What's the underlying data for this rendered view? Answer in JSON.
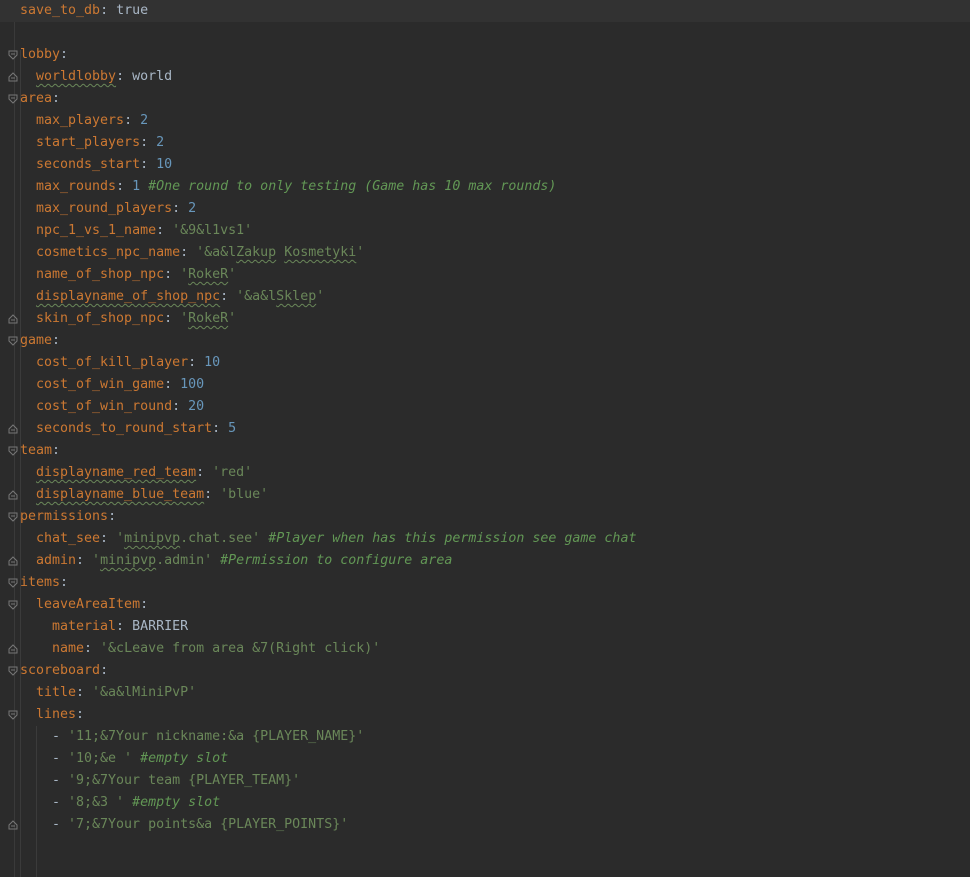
{
  "lines": [
    {
      "indent": 0,
      "fold": "",
      "key": "save_to_db",
      "value": "true",
      "vtype": "b"
    },
    {
      "indent": 0,
      "fold": "",
      "key": "",
      "value": "",
      "vtype": ""
    },
    {
      "indent": 0,
      "fold": "open",
      "key": "lobby",
      "value": "",
      "vtype": ""
    },
    {
      "indent": 1,
      "fold": "end",
      "key": "worldlobby",
      "key_typo": true,
      "value": "world",
      "vtype": "t"
    },
    {
      "indent": 0,
      "fold": "open",
      "key": "area",
      "value": "",
      "vtype": ""
    },
    {
      "indent": 1,
      "fold": "",
      "key": "max_players",
      "value": "2",
      "vtype": "n"
    },
    {
      "indent": 1,
      "fold": "",
      "key": "start_players",
      "value": "2",
      "vtype": "n"
    },
    {
      "indent": 1,
      "fold": "",
      "key": "seconds_start",
      "value": "10",
      "vtype": "n"
    },
    {
      "indent": 1,
      "fold": "",
      "key": "max_rounds",
      "value": "1",
      "vtype": "n",
      "comment": "#One round to only testing (Game has 10 max rounds)"
    },
    {
      "indent": 1,
      "fold": "",
      "key": "max_round_players",
      "value": "2",
      "vtype": "n"
    },
    {
      "indent": 1,
      "fold": "",
      "key": "npc_1_vs_1_name",
      "value": "'&9&l1vs1'",
      "vtype": "s"
    },
    {
      "indent": 1,
      "fold": "",
      "key": "cosmetics_npc_name",
      "value_parts": [
        {
          "text": "'&a&l",
          "typo": false
        },
        {
          "text": "Zakup",
          "typo": true
        },
        {
          "text": " ",
          "typo": false
        },
        {
          "text": "Kosmetyki",
          "typo": true
        },
        {
          "text": "'",
          "typo": false
        }
      ],
      "vtype": "s"
    },
    {
      "indent": 1,
      "fold": "",
      "key": "name_of_shop_npc",
      "value_parts": [
        {
          "text": "'",
          "typo": false
        },
        {
          "text": "RokeR",
          "typo": true
        },
        {
          "text": "'",
          "typo": false
        }
      ],
      "vtype": "s"
    },
    {
      "indent": 1,
      "fold": "",
      "key": "displayname_of_shop_npc",
      "key_typo": true,
      "value_parts": [
        {
          "text": "'&a&l",
          "typo": false
        },
        {
          "text": "Sklep",
          "typo": true
        },
        {
          "text": "'",
          "typo": false
        }
      ],
      "vtype": "s"
    },
    {
      "indent": 1,
      "fold": "end",
      "key": "skin_of_shop_npc",
      "value_parts": [
        {
          "text": "'",
          "typo": false
        },
        {
          "text": "RokeR",
          "typo": true
        },
        {
          "text": "'",
          "typo": false
        }
      ],
      "vtype": "s"
    },
    {
      "indent": 0,
      "fold": "open",
      "key": "game",
      "value": "",
      "vtype": ""
    },
    {
      "indent": 1,
      "fold": "",
      "key": "cost_of_kill_player",
      "value": "10",
      "vtype": "n"
    },
    {
      "indent": 1,
      "fold": "",
      "key": "cost_of_win_game",
      "value": "100",
      "vtype": "n"
    },
    {
      "indent": 1,
      "fold": "",
      "key": "cost_of_win_round",
      "value": "20",
      "vtype": "n"
    },
    {
      "indent": 1,
      "fold": "end",
      "key": "seconds_to_round_start",
      "value": "5",
      "vtype": "n"
    },
    {
      "indent": 0,
      "fold": "open",
      "key": "team",
      "value": "",
      "vtype": ""
    },
    {
      "indent": 1,
      "fold": "",
      "key": "displayname_red_team",
      "key_typo": true,
      "value": "'red'",
      "vtype": "s"
    },
    {
      "indent": 1,
      "fold": "end",
      "key": "displayname_blue_team",
      "key_typo": true,
      "value": "'blue'",
      "vtype": "s"
    },
    {
      "indent": 0,
      "fold": "open",
      "key": "permissions",
      "value": "",
      "vtype": ""
    },
    {
      "indent": 1,
      "fold": "",
      "key": "chat_see",
      "value_parts": [
        {
          "text": "'",
          "typo": false
        },
        {
          "text": "minipvp",
          "typo": true
        },
        {
          "text": ".chat.see'",
          "typo": false
        }
      ],
      "vtype": "s",
      "comment": "#Player when has this permission see game chat"
    },
    {
      "indent": 1,
      "fold": "end",
      "key": "admin",
      "value_parts": [
        {
          "text": "'",
          "typo": false
        },
        {
          "text": "minipvp",
          "typo": true
        },
        {
          "text": ".admin'",
          "typo": false
        }
      ],
      "vtype": "s",
      "comment": "#Permission to configure area"
    },
    {
      "indent": 0,
      "fold": "open",
      "key": "items",
      "value": "",
      "vtype": ""
    },
    {
      "indent": 1,
      "fold": "open",
      "key": "leaveAreaItem",
      "value": "",
      "vtype": ""
    },
    {
      "indent": 2,
      "fold": "",
      "key": "material",
      "value": "BARRIER",
      "vtype": "t"
    },
    {
      "indent": 2,
      "fold": "end",
      "key": "name",
      "value": "'&cLeave from area &7(Right click)'",
      "vtype": "s"
    },
    {
      "indent": 0,
      "fold": "open",
      "key": "scoreboard",
      "value": "",
      "vtype": ""
    },
    {
      "indent": 1,
      "fold": "",
      "key": "title",
      "value": "'&a&lMiniPvP'",
      "vtype": "s"
    },
    {
      "indent": 1,
      "fold": "open",
      "key": "lines",
      "value": "",
      "vtype": ""
    },
    {
      "indent": 2,
      "fold": "",
      "dash": true,
      "value": "'11;&7Your nickname:&a {PLAYER_NAME}'",
      "vtype": "s"
    },
    {
      "indent": 2,
      "fold": "",
      "dash": true,
      "value": "'10;&e '",
      "vtype": "s",
      "comment": "#empty slot"
    },
    {
      "indent": 2,
      "fold": "",
      "dash": true,
      "value": "'9;&7Your team {PLAYER_TEAM}'",
      "vtype": "s"
    },
    {
      "indent": 2,
      "fold": "",
      "dash": true,
      "value": "'8;&3 '",
      "vtype": "s",
      "comment": "#empty slot"
    },
    {
      "indent": 2,
      "fold": "end",
      "dash": true,
      "value": "'7;&7Your points&a {PLAYER_POINTS}'",
      "vtype": "s"
    }
  ],
  "colors": {
    "background": "#2b2b2b",
    "key": "#cc7832",
    "string": "#6a8759",
    "number": "#6897bb",
    "comment": "#629755",
    "plain": "#a9b7c6"
  }
}
